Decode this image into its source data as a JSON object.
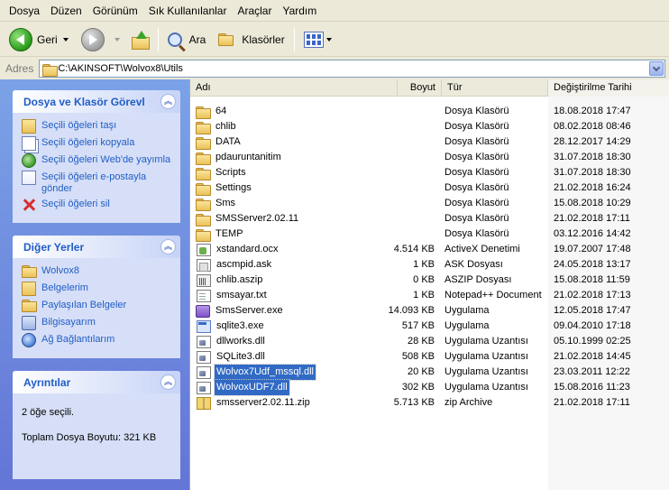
{
  "menu": [
    "Dosya",
    "Düzen",
    "Görünüm",
    "Sık Kullanılanlar",
    "Araçlar",
    "Yardım"
  ],
  "toolbar": {
    "back_label": "Geri",
    "search_label": "Ara",
    "folders_label": "Klasörler"
  },
  "address": {
    "label": "Adres",
    "path": "C:\\AKINSOFT\\Wolvox8\\Utils"
  },
  "taskpane": {
    "tasks": {
      "title": "Dosya ve Klasör Görevl",
      "items": [
        {
          "label": "Seçili öğeleri taşı",
          "icon": "move-icon"
        },
        {
          "label": "Seçili öğeleri kopyala",
          "icon": "copy-icon"
        },
        {
          "label": "Seçili öğeleri Web'de yayımla",
          "icon": "web-publish-icon"
        },
        {
          "label": "Seçili öğeleri e-postayla gönder",
          "icon": "email-icon"
        },
        {
          "label": "Seçili öğeleri sil",
          "icon": "delete-icon"
        }
      ]
    },
    "other": {
      "title": "Diğer Yerler",
      "items": [
        {
          "label": "Wolvox8",
          "icon": "folder-icon"
        },
        {
          "label": "Belgelerim",
          "icon": "my-documents-icon"
        },
        {
          "label": "Paylaşılan Belgeler",
          "icon": "shared-documents-icon"
        },
        {
          "label": "Bilgisayarım",
          "icon": "my-computer-icon"
        },
        {
          "label": "Ağ Bağlantılarım",
          "icon": "network-icon"
        }
      ]
    },
    "details": {
      "title": "Ayrıntılar",
      "selected": "2 öğe seçili.",
      "total": "Toplam Dosya Boyutu: 321 KB"
    }
  },
  "columns": {
    "name": "Adı",
    "size": "Boyut",
    "type": "Tür",
    "date": "Değiştirilme Tarihi"
  },
  "files": [
    {
      "name": "64",
      "size": "",
      "type": "Dosya Klasörü",
      "date": "18.08.2018 17:47",
      "icon": "folder",
      "selected": false
    },
    {
      "name": "chlib",
      "size": "",
      "type": "Dosya Klasörü",
      "date": "08.02.2018 08:46",
      "icon": "folder",
      "selected": false
    },
    {
      "name": "DATA",
      "size": "",
      "type": "Dosya Klasörü",
      "date": "28.12.2017 14:29",
      "icon": "folder",
      "selected": false
    },
    {
      "name": "pdauruntanitim",
      "size": "",
      "type": "Dosya Klasörü",
      "date": "31.07.2018 18:30",
      "icon": "folder",
      "selected": false
    },
    {
      "name": "Scripts",
      "size": "",
      "type": "Dosya Klasörü",
      "date": "31.07.2018 18:30",
      "icon": "folder",
      "selected": false
    },
    {
      "name": "Settings",
      "size": "",
      "type": "Dosya Klasörü",
      "date": "21.02.2018 16:24",
      "icon": "folder",
      "selected": false
    },
    {
      "name": "Sms",
      "size": "",
      "type": "Dosya Klasörü",
      "date": "15.08.2018 10:29",
      "icon": "folder",
      "selected": false
    },
    {
      "name": "SMSServer2.02.11",
      "size": "",
      "type": "Dosya Klasörü",
      "date": "21.02.2018 17:11",
      "icon": "folder",
      "selected": false
    },
    {
      "name": "TEMP",
      "size": "",
      "type": "Dosya Klasörü",
      "date": "03.12.2016 14:42",
      "icon": "folder",
      "selected": false
    },
    {
      "name": "xstandard.ocx",
      "size": "4.514 KB",
      "type": "ActiveX Denetimi",
      "date": "19.07.2007 17:48",
      "icon": "ocx",
      "selected": false
    },
    {
      "name": "ascmpid.ask",
      "size": "1 KB",
      "type": "ASK Dosyası",
      "date": "24.05.2018 13:17",
      "icon": "ask",
      "selected": false
    },
    {
      "name": "chlib.aszip",
      "size": "0 KB",
      "type": "ASZIP Dosyası",
      "date": "15.08.2018 11:59",
      "icon": "aszip",
      "selected": false
    },
    {
      "name": "smsayar.txt",
      "size": "1 KB",
      "type": "Notepad++ Document",
      "date": "21.02.2018 17:13",
      "icon": "txt",
      "selected": false
    },
    {
      "name": "SmsServer.exe",
      "size": "14.093 KB",
      "type": "Uygulama",
      "date": "12.05.2018 17:47",
      "icon": "smsserver",
      "selected": false
    },
    {
      "name": "sqlite3.exe",
      "size": "517 KB",
      "type": "Uygulama",
      "date": "09.04.2010 17:18",
      "icon": "exe",
      "selected": false
    },
    {
      "name": "dllworks.dll",
      "size": "28 KB",
      "type": "Uygulama Uzantısı",
      "date": "05.10.1999 02:25",
      "icon": "dll",
      "selected": false
    },
    {
      "name": "SQLite3.dll",
      "size": "508 KB",
      "type": "Uygulama Uzantısı",
      "date": "21.02.2018 14:45",
      "icon": "dll",
      "selected": false
    },
    {
      "name": "Wolvox7Udf_mssql.dll",
      "size": "20 KB",
      "type": "Uygulama Uzantısı",
      "date": "23.03.2011 12:22",
      "icon": "dll",
      "selected": true
    },
    {
      "name": "WolvoxUDF7.dll",
      "size": "302 KB",
      "type": "Uygulama Uzantısı",
      "date": "15.08.2016 11:23",
      "icon": "dll",
      "selected": true
    },
    {
      "name": "smsserver2.02.11.zip",
      "size": "5.713 KB",
      "type": "zip Archive",
      "date": "21.02.2018 17:11",
      "icon": "zip",
      "selected": false
    }
  ]
}
